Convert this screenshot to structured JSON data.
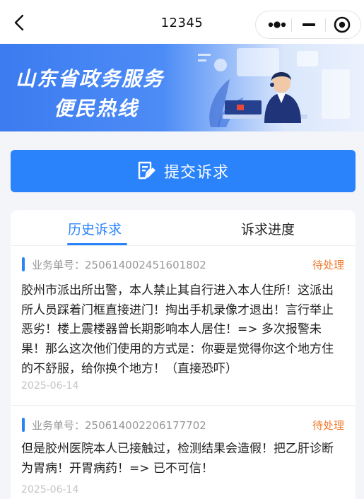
{
  "navbar": {
    "title": "12345",
    "back_icon": "chevron-left-icon",
    "capsule": {
      "more_icon": "more-dots-icon",
      "minimize_icon": "minus-icon",
      "close_icon": "target-circle-icon"
    }
  },
  "banner": {
    "line1": "山东省政务服务",
    "line2": "便民热线"
  },
  "submit": {
    "label": "提交诉求",
    "icon": "edit-form-icon"
  },
  "tabs": [
    {
      "label": "历史诉求",
      "active": true
    },
    {
      "label": "诉求进度",
      "active": false
    }
  ],
  "items": [
    {
      "order_label": "业务单号：",
      "order_no": "250614002451601802",
      "status": "待处理",
      "lines": [
        "胶州市派出所出警，本人禁止其自行进入本人住所！这派出",
        "所人员踩着门框直接进门！掏出手机录像才退出！言行举止",
        "恶劣！楼上震楼器曾长期影响本人居住！=> 多次报警未",
        "果！那么这次他们使用的方式是：你要是觉得你这个地方住",
        "的不舒服，给你换个地方！（直接恐吓）"
      ],
      "date": "2025-06-14"
    },
    {
      "order_label": "业务单号：",
      "order_no": "250614002206177702",
      "status": "待处理",
      "lines": [
        "但是胶州医院本人已接触过，检测结果会造假！把乙肝诊断",
        "为胃病！开胃病药！=> 已不可信！"
      ],
      "date": "2025-06-14"
    }
  ],
  "colors": {
    "accent": "#2a83fb",
    "status_pending": "#f07a2e"
  }
}
